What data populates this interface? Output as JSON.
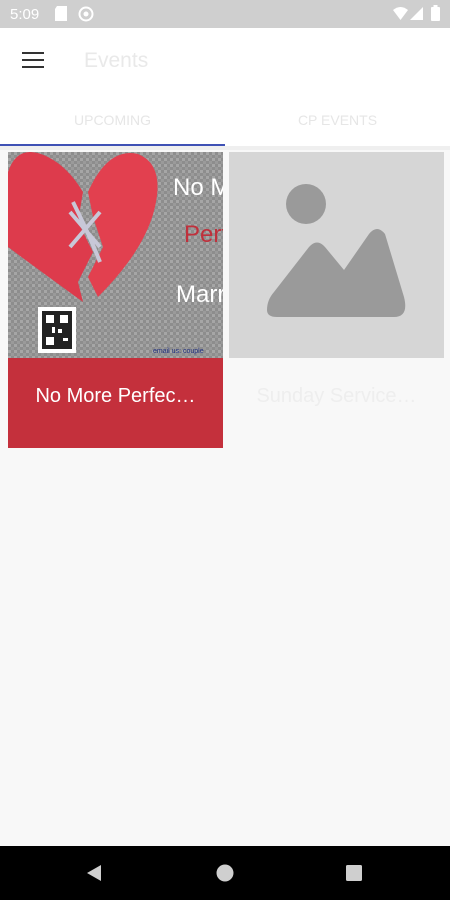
{
  "status_bar": {
    "time": "5:09",
    "icons": [
      "sd-card-icon",
      "sync-icon",
      "wifi-icon",
      "signal-icon",
      "battery-icon"
    ]
  },
  "app_bar": {
    "title": "Events",
    "menu_icon": "hamburger-menu-icon"
  },
  "tabs": [
    {
      "label": "UPCOMING",
      "active": true
    },
    {
      "label": "CP EVENTS",
      "active": false
    }
  ],
  "events": [
    {
      "title": "No More Perfec…",
      "image_text": [
        "No M",
        "Perf",
        "Marr"
      ],
      "image_caption": "email us: couple"
    },
    {
      "title": "Sunday Service…",
      "image": "placeholder-image-icon"
    }
  ],
  "nav_bar": {
    "buttons": [
      "back-icon",
      "home-icon",
      "recents-icon"
    ]
  },
  "colors": {
    "accent": "#3f51b5",
    "card_red": "#c4303c",
    "status_bar": "#cfcfcf",
    "nav_bar": "#000000"
  }
}
